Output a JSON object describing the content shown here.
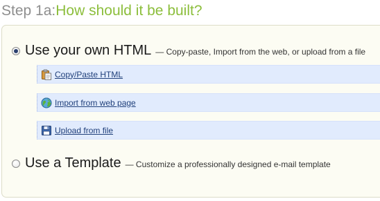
{
  "heading": {
    "prefix": "Step 1a:",
    "question": "How should it be built?"
  },
  "options": [
    {
      "title": "Use your own HTML",
      "description": "— Copy-paste, Import from the web, or upload from a file",
      "selected": true
    },
    {
      "title": "Use a Template",
      "description": "— Customize a professionally designed e-mail template",
      "selected": false
    }
  ],
  "methods": [
    {
      "label": "Copy/Paste HTML",
      "icon": "clipboard-icon"
    },
    {
      "label": "Import from web page",
      "icon": "globe-icon"
    },
    {
      "label": "Upload from file",
      "icon": "floppy-disk-icon"
    }
  ],
  "colors": {
    "heading_prefix": "#8e8e8e",
    "heading_question": "#8cbe3c",
    "panel_background": "#fcfcf3",
    "method_bar_background": "#e1ebfd",
    "link": "#1f3f7a"
  }
}
